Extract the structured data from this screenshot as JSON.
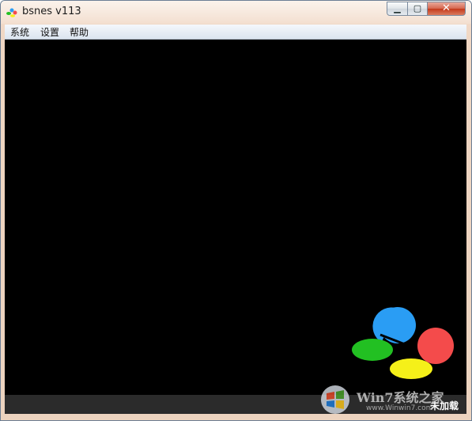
{
  "window": {
    "title": "bsnes v113"
  },
  "menu": {
    "items": [
      "系统",
      "设置",
      "帮助"
    ]
  },
  "status": {
    "text": "未加载"
  },
  "controls": {
    "minimize": "▁",
    "maximize": "▢",
    "close": "✕"
  },
  "logo": {
    "colors": {
      "blue": "#2a9df4",
      "red": "#f44b4b",
      "green": "#22c022",
      "yellow": "#f5f019"
    }
  },
  "watermark": {
    "text": "Win7系统之家",
    "sub": "www.Winwin7.com"
  }
}
